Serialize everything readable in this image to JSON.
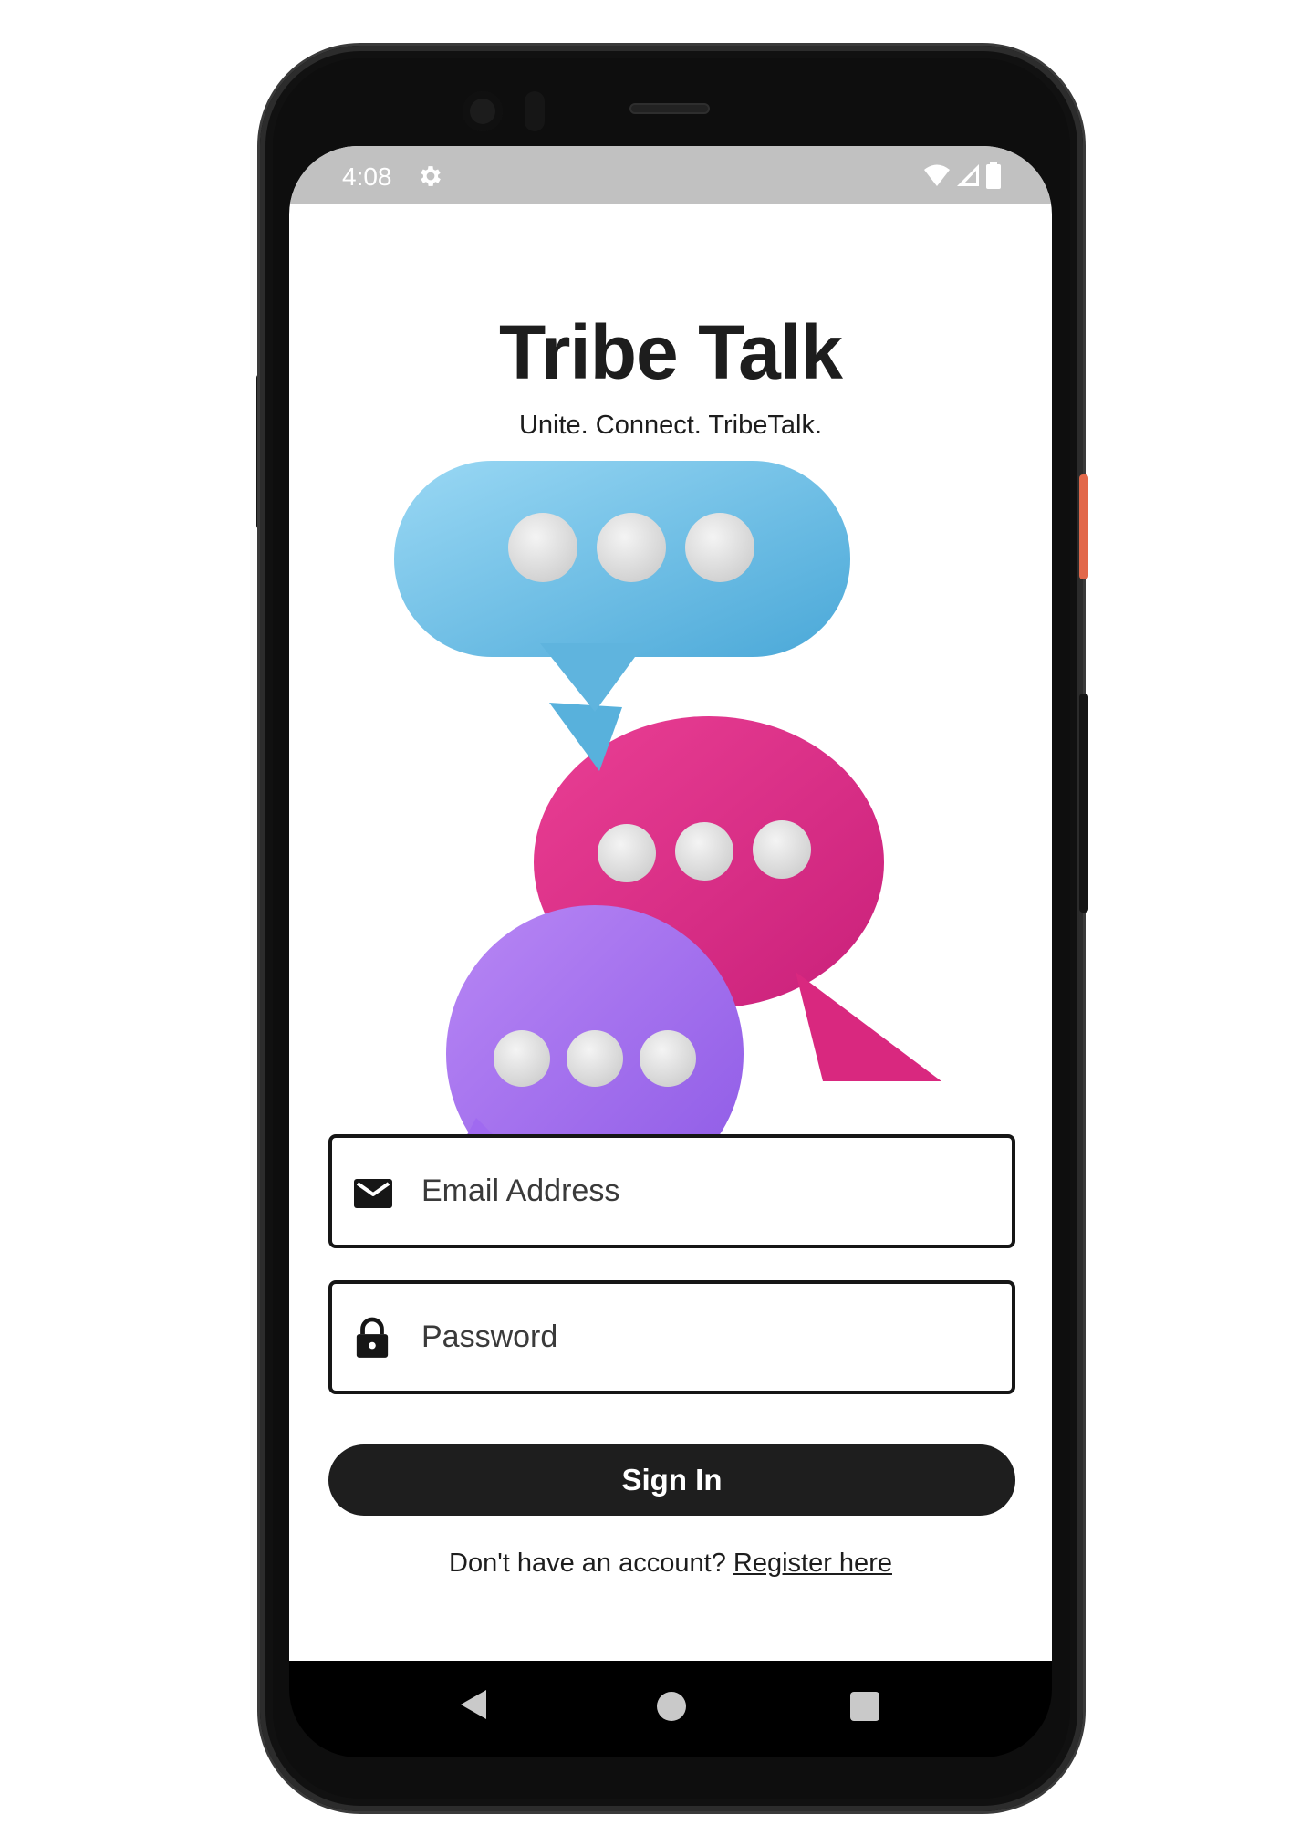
{
  "status_bar": {
    "time": "4:08",
    "icons": [
      "settings-gear-icon",
      "wifi-icon",
      "cell-signal-icon",
      "battery-icon"
    ]
  },
  "app": {
    "title": "Tribe Talk",
    "tagline": "Unite. Connect. TribeTalk."
  },
  "hero": {
    "bubble_colors": [
      "#6ec3e8",
      "#e0318a",
      "#a56cf0"
    ]
  },
  "form": {
    "email": {
      "placeholder": "Email Address",
      "value": "",
      "icon": "envelope-icon"
    },
    "password": {
      "placeholder": "Password",
      "value": "",
      "icon": "lock-icon"
    },
    "signin_label": "Sign In"
  },
  "register": {
    "prompt": "Don't have an account?",
    "link_label": "Register here"
  },
  "nav": {
    "icons": [
      "back-icon",
      "home-icon",
      "recents-icon"
    ]
  },
  "colors": {
    "primary": "#1e1e1e",
    "status_bar": "#c1c1c1",
    "background": "#ffffff"
  }
}
